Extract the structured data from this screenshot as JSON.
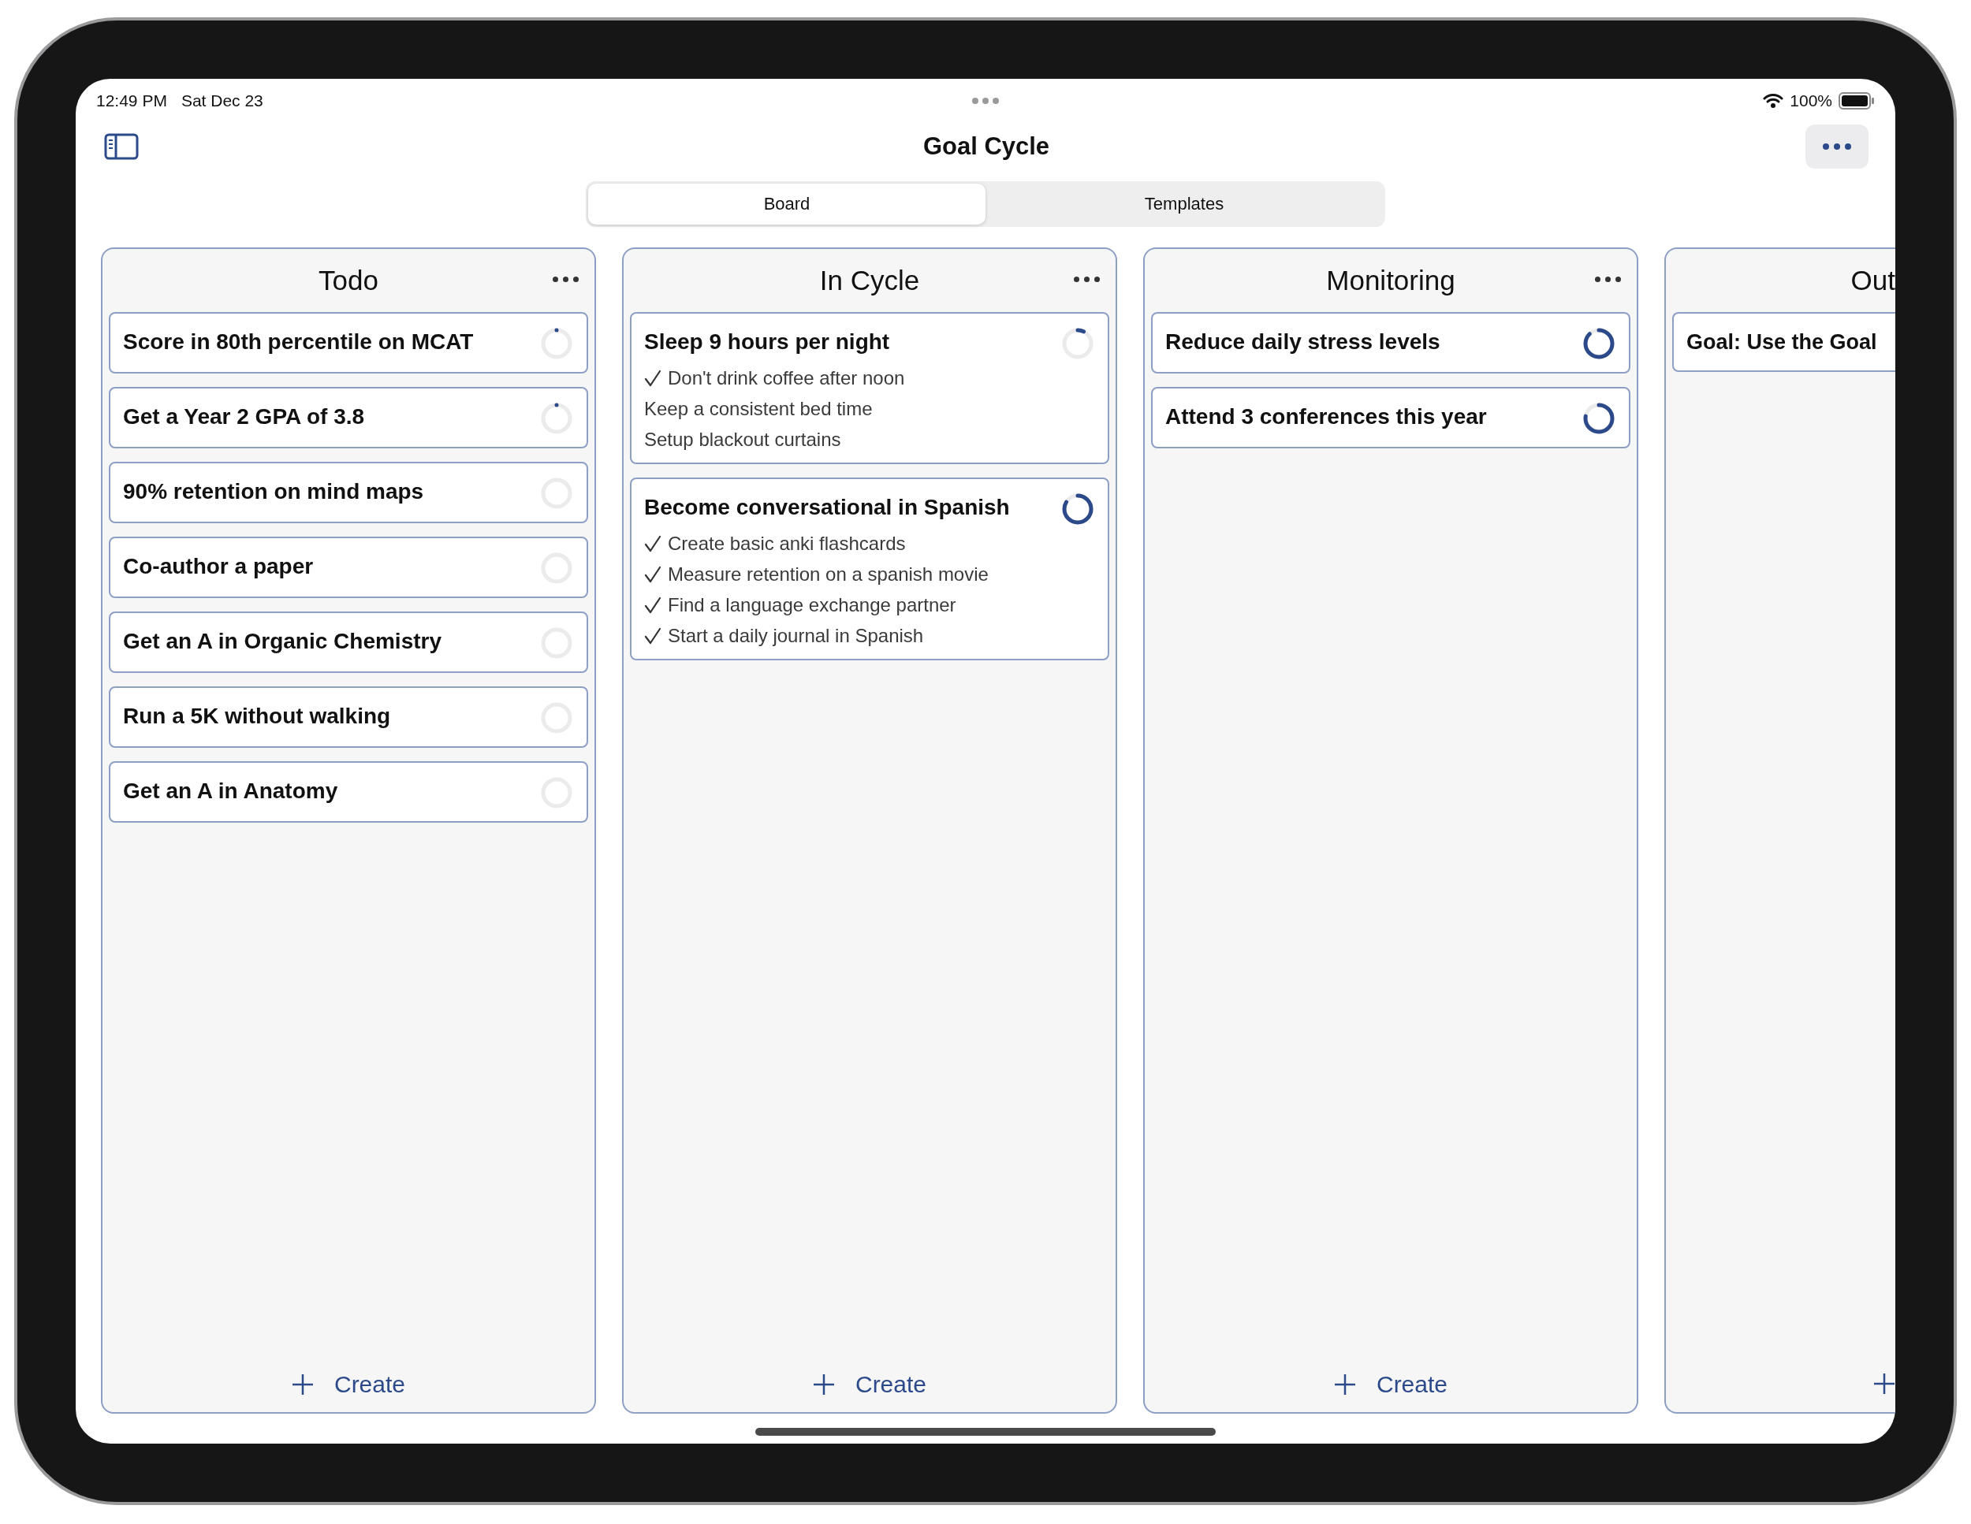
{
  "status_bar": {
    "time": "12:49 PM",
    "date": "Sat Dec 23",
    "battery": "100%"
  },
  "nav": {
    "title": "Goal Cycle"
  },
  "tabs": [
    {
      "label": "Board",
      "selected": true
    },
    {
      "label": "Templates",
      "selected": false
    }
  ],
  "columns": [
    {
      "title": "Todo",
      "kind": "full",
      "create": "Create",
      "cards": [
        {
          "title": "Score in 80th percentile on MCAT",
          "level": 0.03
        },
        {
          "title": "Get a Year 2 GPA of 3.8",
          "level": 0.03
        },
        {
          "title": "90% retention on mind maps",
          "level": 0
        },
        {
          "title": "Co-author a paper",
          "level": 0
        },
        {
          "title": "Get an A in Organic Chemistry",
          "level": 0
        },
        {
          "title": "Run a 5K without walking",
          "level": 0
        },
        {
          "title": "Get an A in Anatomy",
          "level": 0
        }
      ]
    },
    {
      "title": "In Cycle",
      "kind": "full",
      "create": "Create",
      "cards": [
        {
          "title": "Sleep 9 hours per night",
          "level": 0.12,
          "subtasks": [
            {
              "text": "Don't drink coffee after noon",
              "checked": true
            },
            {
              "text": "Keep a consistent bed time",
              "checked": false
            },
            {
              "text": "Setup blackout curtains",
              "checked": false
            }
          ]
        },
        {
          "title": "Become conversational in Spanish",
          "level": 0.88,
          "subtasks": [
            {
              "text": "Create basic anki flashcards",
              "checked": true
            },
            {
              "text": "Measure retention on a spanish movie",
              "checked": true
            },
            {
              "text": "Find a language exchange partner",
              "checked": true
            },
            {
              "text": "Start a daily journal in Spanish",
              "checked": true
            }
          ]
        }
      ]
    },
    {
      "title": "Monitoring",
      "kind": "full",
      "create": "Create",
      "cards": [
        {
          "title": "Reduce daily stress levels",
          "level": 0.92
        },
        {
          "title": "Attend 3 conferences this year",
          "level": 0.82
        }
      ]
    },
    {
      "title": "Out",
      "kind": "partial",
      "cards": [
        {
          "title": "Goal: Use the Goal"
        }
      ]
    }
  ]
}
